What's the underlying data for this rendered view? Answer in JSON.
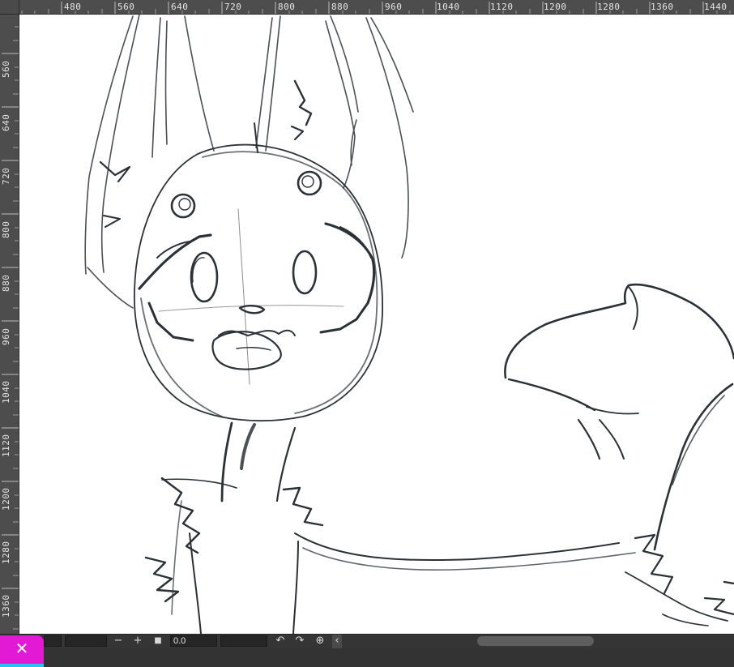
{
  "ruler": {
    "top": [
      "480",
      "560",
      "640",
      "720",
      "800",
      "880",
      "960",
      "1040",
      "1120",
      "1200",
      "1280",
      "1360",
      "1440"
    ],
    "left": [
      "560",
      "640",
      "720",
      "800",
      "880",
      "960",
      "1040",
      "1120",
      "1200",
      "1280",
      "1360"
    ]
  },
  "bottombar": {
    "zoom_out": "−",
    "zoom_in": "+",
    "stop": "■",
    "rotation_value": "0.0",
    "rotate_left": "↶",
    "rotate_right": "↷",
    "reset_rotation": "⊕",
    "collapse": "‹"
  },
  "close_button": {
    "label": "✕"
  },
  "colors": {
    "canvas": "#ffffff",
    "ui": "#3a3a3a",
    "accent": "#e21ad6",
    "accent2": "#25c5f0",
    "sketch": "#2b3236"
  }
}
